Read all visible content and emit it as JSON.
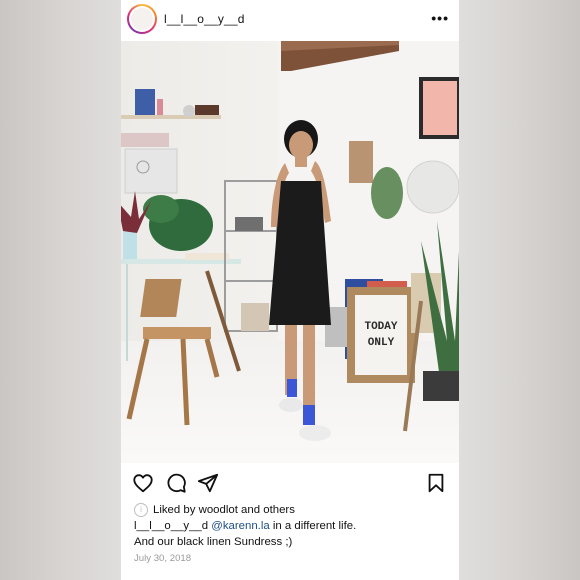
{
  "post": {
    "username": "l__l__o__y__d",
    "more_label": "•••",
    "liked_by": {
      "prefix": "Liked by ",
      "user": "woodlot",
      "middle": " and ",
      "others": "others"
    },
    "caption": {
      "username": "l__l__o__y__d",
      "mention": "@karenn.la",
      "text_line1": " in a different life.",
      "text_line2": "And our black linen Sundress ;)"
    },
    "date": "July 30, 2018",
    "photo_sign": {
      "line1": "TODAY",
      "line2": "ONLY"
    }
  },
  "icons": {
    "like": "heart-icon",
    "comment": "comment-icon",
    "share": "send-icon",
    "save": "bookmark-icon",
    "info": "info-icon",
    "more": "more-options-icon"
  },
  "colors": {
    "story_ring": [
      "#fbbf3c",
      "#f58529",
      "#dd2a7b",
      "#8134af"
    ],
    "mention": "#1d4f86",
    "date": "#9a9a9a"
  }
}
